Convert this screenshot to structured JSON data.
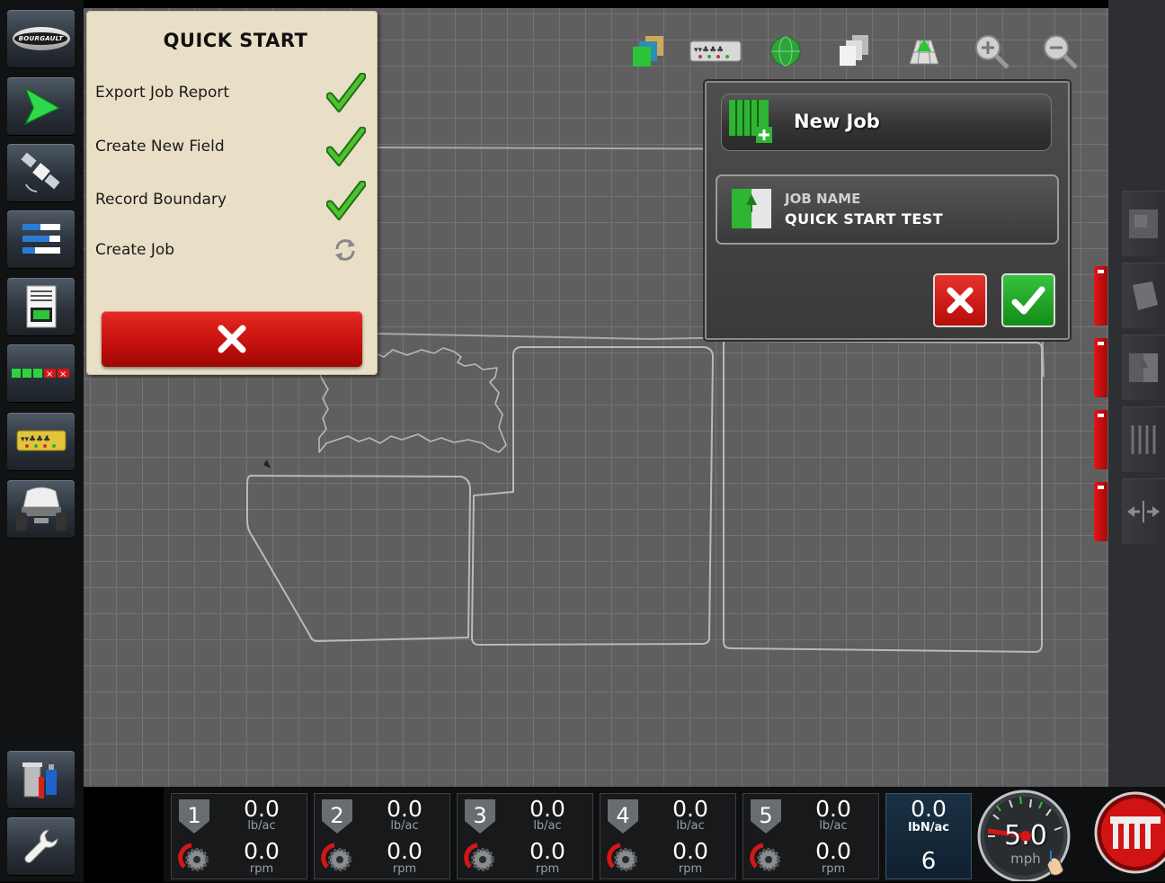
{
  "left_sidebar": {
    "logo_text": "BOURGAULT",
    "items": [
      {
        "name": "guidance-arrow-icon"
      },
      {
        "name": "satellite-icon"
      },
      {
        "name": "list-view-icon"
      },
      {
        "name": "job-report-icon"
      },
      {
        "name": "section-status-icon"
      },
      {
        "name": "implement-icon"
      },
      {
        "name": "seeder-cart-icon"
      },
      {
        "name": "data-transfer-icon"
      },
      {
        "name": "wrench-icon"
      }
    ]
  },
  "top_toolbar": [
    "layers-icon",
    "implement-sections-icon",
    "globe-icon",
    "pages-icon",
    "field-view-icon",
    "zoom-in-icon",
    "zoom-out-icon"
  ],
  "quick_start": {
    "title": "QUICK START",
    "items": [
      {
        "label": "Export Job Report",
        "status": "done"
      },
      {
        "label": "Create New Field",
        "status": "done"
      },
      {
        "label": "Record Boundary",
        "status": "done"
      },
      {
        "label": "Create Job",
        "status": "in-progress"
      }
    ]
  },
  "new_job": {
    "title": "New Job",
    "job_name_label": "JOB NAME",
    "job_name_value": "QUICK START TEST"
  },
  "sections": [
    {
      "number": "1",
      "rate": "0.0",
      "rate_unit": "lb/ac",
      "speed": "0.0",
      "speed_unit": "rpm"
    },
    {
      "number": "2",
      "rate": "0.0",
      "rate_unit": "lb/ac",
      "speed": "0.0",
      "speed_unit": "rpm"
    },
    {
      "number": "3",
      "rate": "0.0",
      "rate_unit": "lb/ac",
      "speed": "0.0",
      "speed_unit": "rpm"
    },
    {
      "number": "4",
      "rate": "0.0",
      "rate_unit": "lb/ac",
      "speed": "0.0",
      "speed_unit": "rpm"
    },
    {
      "number": "5",
      "rate": "0.0",
      "rate_unit": "lb/ac",
      "speed": "0.0",
      "speed_unit": "rpm"
    }
  ],
  "target_rate": {
    "value": "0.0",
    "unit": "lbN/ac",
    "count": "6"
  },
  "speedometer": {
    "value": "5.0",
    "unit": "mph"
  },
  "colors": {
    "accent_red": "#c5100c",
    "accent_green": "#2fb434",
    "map_bg": "#5f5f5f"
  }
}
